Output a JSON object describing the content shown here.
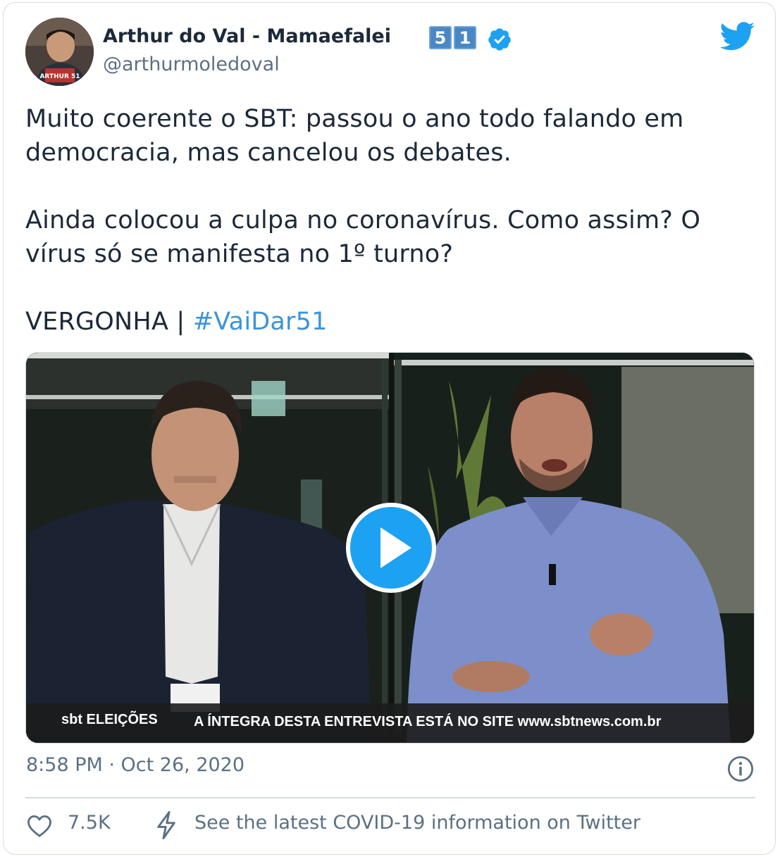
{
  "author": {
    "display_name": "Arthur do Val - Mamaefalei",
    "badge_digits": [
      "5",
      "1"
    ],
    "handle": "@arthurmoledoval",
    "avatar_caption": "ARTHUR 51"
  },
  "tweet": {
    "paragraph1_line1": "Muito coerente o SBT: passou o ano todo falando em",
    "paragraph1_line2": "democracia, mas cancelou os debates.",
    "paragraph2_line1": "Ainda colocou a culpa no coronavírus. Como assim? O",
    "paragraph2_line2": "vírus só se manifesta no 1º turno?",
    "paragraph3_text": "VERGONHA | ",
    "hashtag": "#VaiDar51"
  },
  "media": {
    "lower_third_logo": "sbt ELEIÇÕES",
    "lower_third_text": "A ÍNTEGRA DESTA ENTREVISTA ESTÁ NO SITE www.sbtnews.com.br"
  },
  "meta": {
    "timestamp": "8:58 PM · Oct 26, 2020",
    "likes": "7.5K",
    "covid_link": "See the latest COVID-19 information on Twitter"
  },
  "colors": {
    "accent": "#1da1f2",
    "hashtag": "#3b94d9",
    "secondary_text": "#5b7083",
    "verified": "#1da1f2"
  },
  "icons": [
    "twitter-bird-icon",
    "verified-badge-icon",
    "play-icon",
    "info-icon",
    "heart-icon",
    "bolt-icon"
  ]
}
